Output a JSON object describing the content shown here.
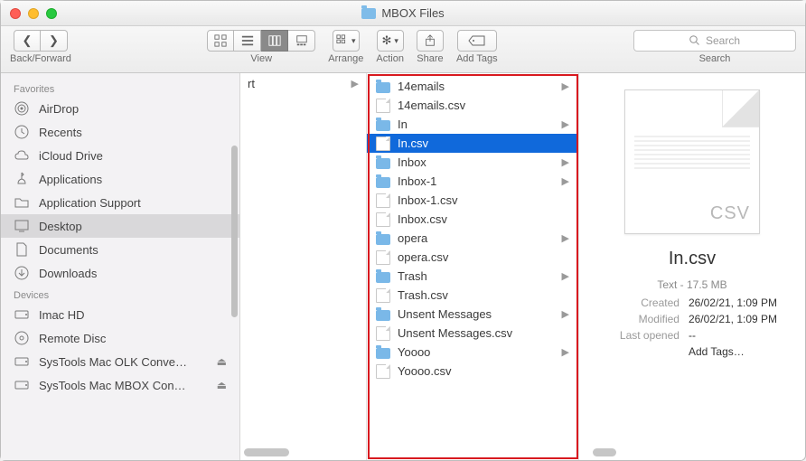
{
  "window": {
    "title": "MBOX Files"
  },
  "toolbar": {
    "back_forward_label": "Back/Forward",
    "view_label": "View",
    "arrange_label": "Arrange",
    "action_label": "Action",
    "share_label": "Share",
    "add_tags_label": "Add Tags",
    "search_label": "Search",
    "search_placeholder": "Search"
  },
  "sidebar": {
    "favorites_header": "Favorites",
    "devices_header": "Devices",
    "favorites": [
      {
        "label": "AirDrop",
        "icon": "airdrop"
      },
      {
        "label": "Recents",
        "icon": "recents"
      },
      {
        "label": "iCloud Drive",
        "icon": "icloud"
      },
      {
        "label": "Applications",
        "icon": "applications"
      },
      {
        "label": "Application Support",
        "icon": "folder"
      },
      {
        "label": "Desktop",
        "icon": "desktop",
        "selected": true
      },
      {
        "label": "Documents",
        "icon": "documents"
      },
      {
        "label": "Downloads",
        "icon": "downloads"
      }
    ],
    "devices": [
      {
        "label": "Imac HD",
        "icon": "hd"
      },
      {
        "label": "Remote Disc",
        "icon": "disc"
      },
      {
        "label": "SysTools Mac OLK Conve…",
        "icon": "hd",
        "eject": true
      },
      {
        "label": "SysTools Mac MBOX Con…",
        "icon": "hd",
        "eject": true
      }
    ]
  },
  "col1": {
    "item": "rt"
  },
  "files": [
    {
      "name": "14emails",
      "type": "folder",
      "expandable": true
    },
    {
      "name": "14emails.csv",
      "type": "file"
    },
    {
      "name": "In",
      "type": "folder",
      "expandable": true
    },
    {
      "name": "In.csv",
      "type": "file",
      "selected": true
    },
    {
      "name": "Inbox",
      "type": "folder",
      "expandable": true
    },
    {
      "name": "Inbox-1",
      "type": "folder",
      "expandable": true
    },
    {
      "name": "Inbox-1.csv",
      "type": "file"
    },
    {
      "name": "Inbox.csv",
      "type": "file"
    },
    {
      "name": "opera",
      "type": "folder",
      "expandable": true
    },
    {
      "name": "opera.csv",
      "type": "file"
    },
    {
      "name": "Trash",
      "type": "folder",
      "expandable": true
    },
    {
      "name": "Trash.csv",
      "type": "file"
    },
    {
      "name": "Unsent Messages",
      "type": "folder",
      "expandable": true
    },
    {
      "name": "Unsent Messages.csv",
      "type": "file"
    },
    {
      "name": "Yoooo",
      "type": "folder",
      "expandable": true
    },
    {
      "name": "Yoooo.csv",
      "type": "file"
    }
  ],
  "preview": {
    "badge": "CSV",
    "filename": "In.csv",
    "kind_size": "Text - 17.5 MB",
    "created_label": "Created",
    "created_value": "26/02/21, 1:09 PM",
    "modified_label": "Modified",
    "modified_value": "26/02/21, 1:09 PM",
    "last_opened_label": "Last opened",
    "last_opened_value": "--",
    "add_tags": "Add Tags…"
  }
}
